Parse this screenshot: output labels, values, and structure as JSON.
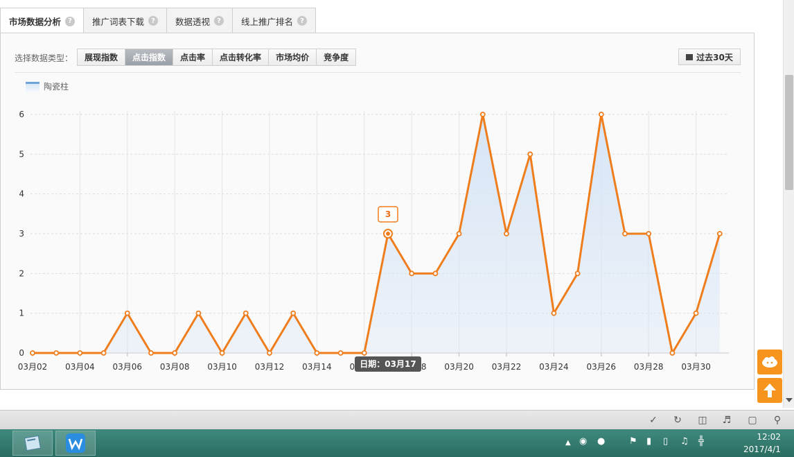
{
  "tabs": [
    {
      "label": "市场数据分析",
      "active": true
    },
    {
      "label": "推广词表下载",
      "active": false
    },
    {
      "label": "数据透视",
      "active": false
    },
    {
      "label": "线上推广排名",
      "active": false
    }
  ],
  "help_glyph": "?",
  "toolbar": {
    "label": "选择数据类型：",
    "types": [
      "展现指数",
      "点击指数",
      "点击率",
      "点击转化率",
      "市场均价",
      "竞争度"
    ],
    "active_type": "点击指数",
    "range_label": "过去30天"
  },
  "legend": {
    "label": "陶瓷柱"
  },
  "tooltip": {
    "value_label": "3",
    "date_label": "日期：03月17"
  },
  "chart_data": {
    "type": "area",
    "series": [
      {
        "name": "陶瓷柱",
        "x": [
          "03月02",
          "03月03",
          "03月04",
          "03月05",
          "03月06",
          "03月07",
          "03月08",
          "03月09",
          "03月10",
          "03月11",
          "03月12",
          "03月13",
          "03月14",
          "03月15",
          "03月16",
          "03月17",
          "03月18",
          "03月19",
          "03月20",
          "03月21",
          "03月22",
          "03月23",
          "03月24",
          "03月25",
          "03月26",
          "03月27",
          "03月28",
          "03月29",
          "03月30",
          "03月31"
        ],
        "values": [
          0,
          0,
          0,
          0,
          1,
          0,
          0,
          1,
          0,
          1,
          0,
          1,
          0,
          0,
          0,
          3,
          2,
          2,
          3,
          6,
          3,
          5,
          1,
          2,
          6,
          3,
          3,
          0,
          1,
          3
        ]
      }
    ],
    "x_tick_labels": [
      "03月02",
      "03月04",
      "03月06",
      "03月08",
      "03月10",
      "03月12",
      "03月14",
      "03月16",
      "03月18",
      "03月20",
      "03月22",
      "03月24",
      "03月26",
      "03月28",
      "03月30"
    ],
    "y_ticks": [
      0,
      1,
      2,
      3,
      4,
      5,
      6
    ],
    "ylim": [
      0,
      6
    ],
    "highlight_index": 15,
    "line_color": "#f07d1c",
    "fill_color": "#d7e5f6",
    "title": "",
    "xlabel": "",
    "ylabel": "",
    "grid": true
  },
  "colors": {
    "accent": "#f7941d",
    "taskbar": "#2f7466"
  },
  "icons": {
    "side": [
      "feedback-cloud-icon",
      "back-to-top-icon"
    ],
    "bottom": [
      "pin-icon",
      "refresh-icon",
      "trash-icon",
      "volume-icon",
      "window-icon",
      "search-icon"
    ],
    "taskbar_apps": [
      "notepad-app-icon",
      "wps-app-icon"
    ],
    "tray": [
      "arrow-up-icon",
      "wechat-icon",
      "qq-icon",
      "flag-icon",
      "battery-icon",
      "signal-icon",
      "speaker-icon",
      "ime-icon"
    ]
  },
  "clock": {
    "time": "12:02",
    "date": "2017/4/1"
  }
}
